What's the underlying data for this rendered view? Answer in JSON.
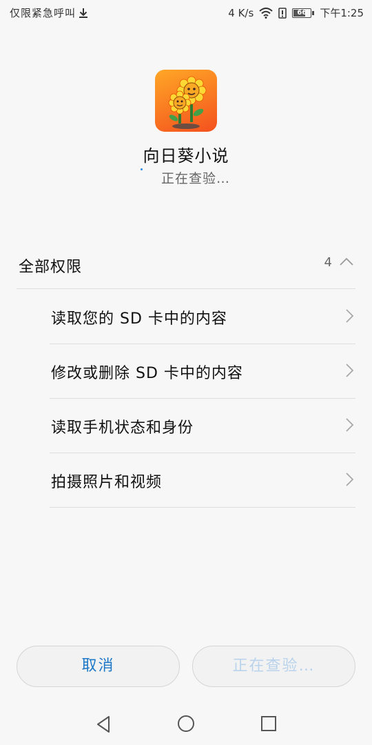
{
  "status_bar": {
    "left_text": "仅限紧急呼叫",
    "speed": "4 K/s",
    "battery": "66",
    "time": "下午1:25",
    "icons": [
      "download-icon",
      "wifi-icon",
      "alert-icon",
      "battery-icon"
    ]
  },
  "app": {
    "name": "向日葵小说",
    "status": "正在查验…",
    "icon": "sunflower-app-icon"
  },
  "permissions": {
    "title": "全部权限",
    "count": "4",
    "items": [
      {
        "label": "读取您的 SD 卡中的内容"
      },
      {
        "label": "修改或删除 SD 卡中的内容"
      },
      {
        "label": "读取手机状态和身份"
      },
      {
        "label": "拍摄照片和视频"
      }
    ]
  },
  "buttons": {
    "cancel": "取消",
    "install": "正在查验…"
  },
  "colors": {
    "accent": "#1e78c8",
    "disabled_text": "#b9d3ec",
    "background": "#f7f7f7"
  }
}
